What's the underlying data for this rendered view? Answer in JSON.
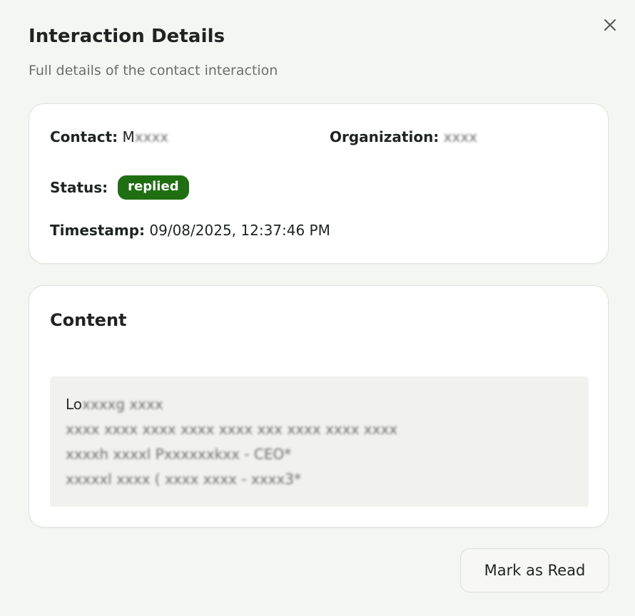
{
  "dialog": {
    "title": "Interaction Details",
    "subtitle": "Full details of the contact interaction",
    "close_icon": "close-icon"
  },
  "details": {
    "contact_label": "Contact:",
    "contact_visible": "M",
    "contact_redacted": "xxxx",
    "organization_label": "Organization:",
    "organization_redacted": "xxxx",
    "status_label": "Status:",
    "status_value": "replied",
    "status_color": "#1f6f12",
    "timestamp_label": "Timestamp:",
    "timestamp_value": "09/08/2025, 12:37:46 PM"
  },
  "content": {
    "heading": "Content",
    "line1_visible": "Lo",
    "line1_redacted": "xxxxg xxxx",
    "line2_redacted": "xxxx xxxx xxxx xxxx xxxx xxx xxxx xxxx xxxx",
    "line3_redacted": "xxxxh xxxxl Pxxxxxxkxx - CEO*",
    "line4_redacted": "xxxxxl xxxx ( xxxx xxxx - xxxx3*"
  },
  "actions": {
    "mark_as_read_label": "Mark as Read"
  }
}
